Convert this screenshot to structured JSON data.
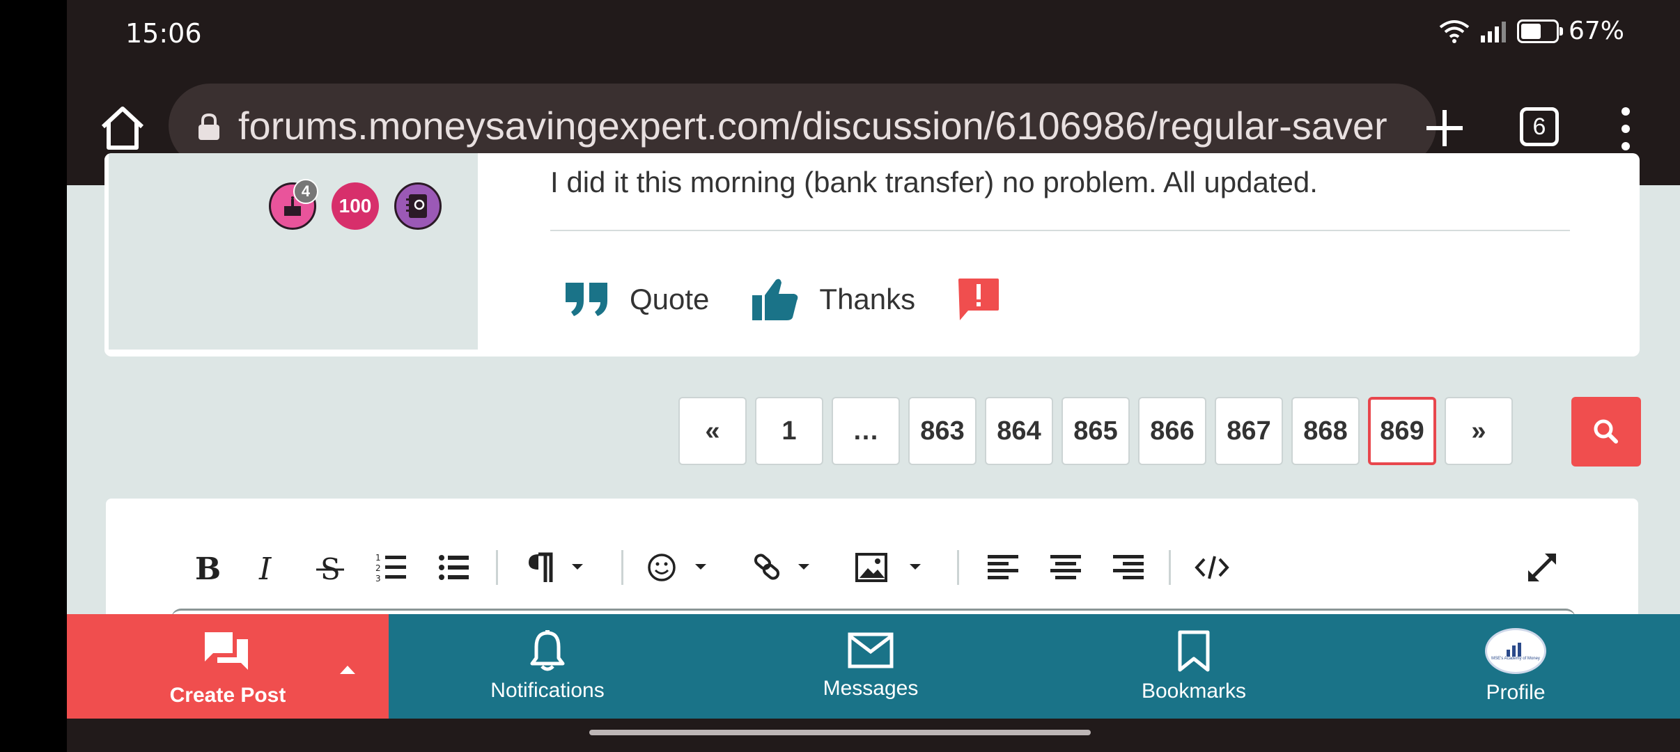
{
  "status": {
    "time": "15:06",
    "battery": "67%",
    "battery_level": 0.67
  },
  "browser": {
    "url": "forums.moneysavingexpert.com/discussion/6106986/regular-saver",
    "tab_count": "6"
  },
  "post": {
    "text": "I did it this morning (bank transfer)  no problem.  All updated.",
    "badges": {
      "cake_count": "4",
      "hundred": "100"
    },
    "actions": {
      "quote": "Quote",
      "thanks": "Thanks"
    }
  },
  "pagination": {
    "prev": "«",
    "first": "1",
    "ellipsis": "…",
    "pages": [
      "863",
      "864",
      "865",
      "866",
      "867",
      "868"
    ],
    "current": "869",
    "next": "»"
  },
  "bottom_nav": {
    "create_post": "Create Post",
    "notifications": "Notifications",
    "messages": "Messages",
    "bookmarks": "Bookmarks",
    "profile": "Profile",
    "profile_avatar_text": "MSE's Academy of Money"
  },
  "colors": {
    "accent_red": "#f04e4e",
    "teal": "#1a7388",
    "background": "#dde6e5"
  }
}
